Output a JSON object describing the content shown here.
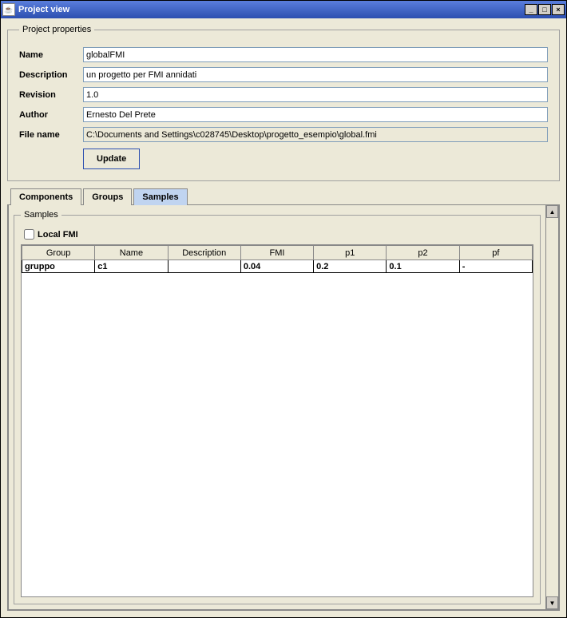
{
  "window": {
    "title": "Project view"
  },
  "properties": {
    "legend": "Project properties",
    "name_label": "Name",
    "name_value": "globalFMI",
    "description_label": "Description",
    "description_value": "un progetto per FMI annidati",
    "revision_label": "Revision",
    "revision_value": "1.0",
    "author_label": "Author",
    "author_value": "Ernesto Del Prete",
    "filename_label": "File name",
    "filename_value": "C:\\Documents and Settings\\c028745\\Desktop\\progetto_esempio\\global.fmi",
    "update_button": "Update"
  },
  "tabs": {
    "components": "Components",
    "groups": "Groups",
    "samples": "Samples"
  },
  "samples": {
    "legend": "Samples",
    "local_fmi_label": "Local FMI",
    "headers": {
      "group": "Group",
      "name": "Name",
      "description": "Description",
      "fmi": "FMI",
      "p1": "p1",
      "p2": "p2",
      "pf": "pf"
    },
    "rows": [
      {
        "group": "gruppo",
        "name": "c1",
        "description": "",
        "fmi": "0.04",
        "p1": "0.2",
        "p2": "0.1",
        "pf": "-"
      }
    ]
  }
}
